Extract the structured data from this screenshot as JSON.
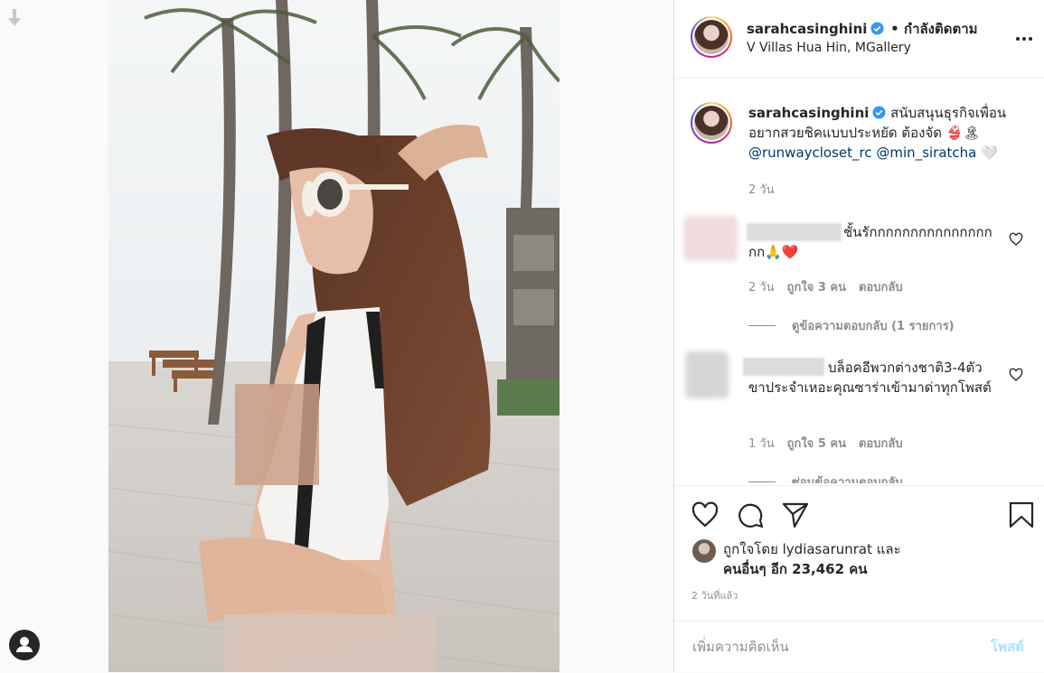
{
  "post": {
    "author": "sarahcasinghini",
    "follow_state": "• กำลังติดตาม",
    "location": "V Villas Hua Hin, MGallery"
  },
  "caption": {
    "author": "sarahcasinghini",
    "text": "สนับสนุนธุรกิจเพื่อนอยากสวยชิคแบบประหยัด ต้องจัด 👙🏝",
    "mention1": "@runwaycloset_rc",
    "mention2": "@min_siratcha",
    "emoji_end": "🤍",
    "time": "2 วัน"
  },
  "comments": [
    {
      "text": "ชั้นรักกกกกกกกกกกกกกกกก🙏❤️",
      "time": "2 วัน",
      "likes": "ถูกใจ 3 คน",
      "reply": "ตอบกลับ",
      "replies_label": "ดูข้อความตอบกลับ (1 รายการ)"
    },
    {
      "text": "บล็อคอีพวกต่างชาติ3-4ตัวขาประจำเหอะคุณซาร่าเข้ามาด่าทุกโพสต์",
      "time": "1 วัน",
      "likes": "ถูกใจ 5 คน",
      "reply": "ตอบกลับ",
      "replies_label": "ซ่อนข้อความตอบกลับ"
    }
  ],
  "likes": {
    "line1": "ถูกใจโดย lydiasarunrat และ",
    "line2": "คนอื่นๆ อีก 23,462 คน"
  },
  "date": "2 วันที่แล้ว",
  "add_comment": {
    "placeholder": "เพิ่มความคิดเห็น",
    "post_label": "โพสต์"
  },
  "icons": [
    "arrow-down-icon",
    "user-icon",
    "verified-icon",
    "more-icon",
    "heart-icon",
    "comment-icon",
    "share-icon",
    "bookmark-icon"
  ],
  "colors": {
    "verified": "#3897f0",
    "link": "#00376b",
    "post_disabled": "#b2dffc",
    "heart_red": "#ed4956"
  }
}
